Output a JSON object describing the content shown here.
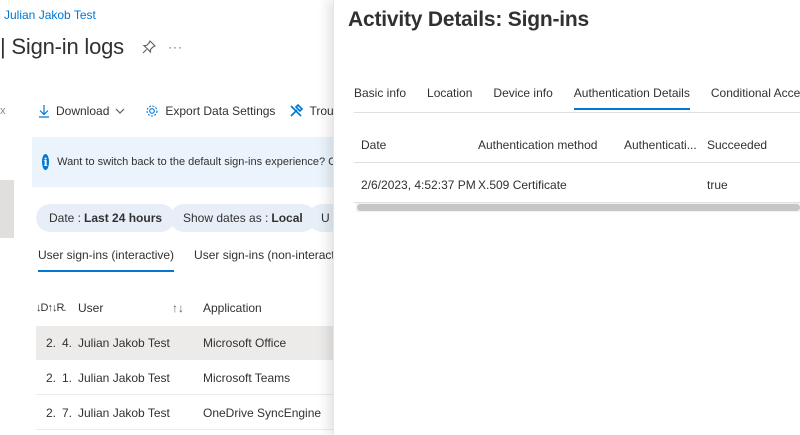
{
  "background_page": {
    "breadcrumb": "Julian Jakob Test",
    "title": "| Sign-in logs",
    "more": "···",
    "close_glyph": "x",
    "toolbar": {
      "download_label": "Download",
      "export_label": "Export Data Settings",
      "troubleshoot_label": "Troubleshoo"
    },
    "banner_text": "Want to switch back to the default sign-ins experience? Click",
    "filters": [
      {
        "prefix": "Date :",
        "value": "Last 24 hours"
      },
      {
        "prefix": "Show dates as :",
        "value": "Local"
      },
      {
        "prefix": "U",
        "value": ""
      }
    ],
    "tabs": [
      {
        "label": "User sign-ins (interactive)",
        "active": true
      },
      {
        "label": "User sign-ins (non-interactive)",
        "active": false
      }
    ],
    "grid": {
      "sort_header": "↓D↑↓R.",
      "user_header": "User",
      "sort_arrows": "↑↓",
      "app_header": "Application",
      "rows": [
        {
          "a": "2.",
          "b": "4.",
          "user": "Julian Jakob Test",
          "app": "Microsoft Office",
          "selected": true
        },
        {
          "a": "2.",
          "b": "1.",
          "user": "Julian Jakob Test",
          "app": "Microsoft Teams",
          "selected": false
        },
        {
          "a": "2.",
          "b": "7.",
          "user": "Julian Jakob Test",
          "app": "OneDrive SyncEngine",
          "selected": false
        }
      ]
    }
  },
  "panel": {
    "title": "Activity Details: Sign-ins",
    "tabs": [
      {
        "label": "Basic info",
        "active": false
      },
      {
        "label": "Location",
        "active": false
      },
      {
        "label": "Device info",
        "active": false
      },
      {
        "label": "Authentication Details",
        "active": true
      },
      {
        "label": "Conditional Access",
        "active": false
      }
    ],
    "table": {
      "headers": [
        "Date",
        "Authentication method",
        "Authenticati...",
        "Succeeded"
      ],
      "rows": [
        [
          "2/6/2023, 4:52:37 PM",
          "X.509 Certificate",
          "",
          "true"
        ]
      ]
    }
  },
  "colors": {
    "accent": "#0078d4",
    "banner_bg": "#ebf3fc",
    "pill_bg": "#e7eef8",
    "selected_row": "#edebe9"
  }
}
